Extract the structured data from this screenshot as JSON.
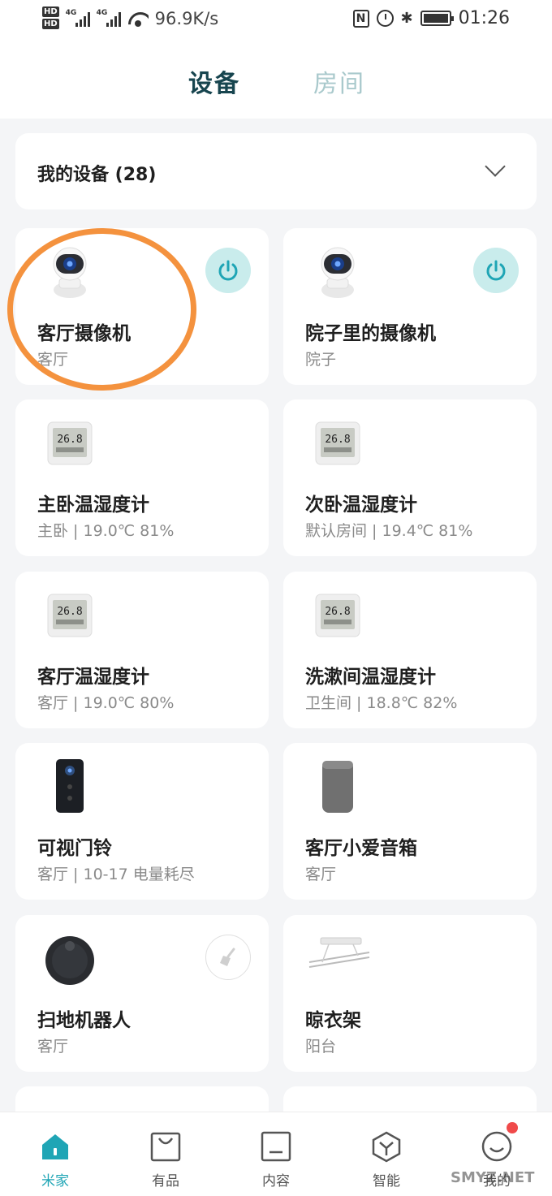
{
  "status_bar": {
    "network_speed": "96.9K/s",
    "signal_1": "4G",
    "signal_2": "4G",
    "hd_1": "HD",
    "hd_2": "HD",
    "nfc": "N",
    "time": "01:26"
  },
  "header": {
    "tabs": [
      {
        "label": "设备",
        "active": true
      },
      {
        "label": "房间",
        "active": false
      }
    ]
  },
  "device_selector": {
    "label": "我的设备 (28)"
  },
  "devices": [
    {
      "name": "客厅摄像机",
      "subtitle": "客厅",
      "icon": "camera-icon",
      "has_power": true
    },
    {
      "name": "院子里的摄像机",
      "subtitle": "院子",
      "icon": "camera-icon",
      "has_power": true
    },
    {
      "name": "主卧温湿度计",
      "subtitle": "主卧 | 19.0℃ 81%",
      "icon": "thermometer-icon"
    },
    {
      "name": "次卧温湿度计",
      "subtitle": "默认房间 | 19.4℃ 81%",
      "icon": "thermometer-icon"
    },
    {
      "name": "客厅温湿度计",
      "subtitle": "客厅 | 19.0℃ 80%",
      "icon": "thermometer-icon"
    },
    {
      "name": "洗漱间温湿度计",
      "subtitle": "卫生间 | 18.8℃ 82%",
      "icon": "thermometer-icon"
    },
    {
      "name": "可视门铃",
      "subtitle": "客厅 | 10-17 电量耗尽",
      "icon": "doorbell-icon"
    },
    {
      "name": "客厅小爱音箱",
      "subtitle": "客厅",
      "icon": "speaker-icon"
    },
    {
      "name": "扫地机器人",
      "subtitle": "客厅",
      "icon": "robot-vacuum-icon",
      "has_clean": true
    },
    {
      "name": "晾衣架",
      "subtitle": "阳台",
      "icon": "clothes-rack-icon"
    }
  ],
  "thermo_display": "26.8",
  "bottom_nav": [
    {
      "label": "米家",
      "icon": "home-icon",
      "active": true
    },
    {
      "label": "有品",
      "icon": "shopping-bag-icon"
    },
    {
      "label": "内容",
      "icon": "content-icon"
    },
    {
      "label": "智能",
      "icon": "smart-cube-icon"
    },
    {
      "label": "我的",
      "icon": "profile-icon",
      "badge": true
    }
  ],
  "watermark": "SMYZ.NET",
  "colors": {
    "accent": "#1fa5b5",
    "highlight": "#f4923e",
    "power_bg": "#c9ecec"
  }
}
